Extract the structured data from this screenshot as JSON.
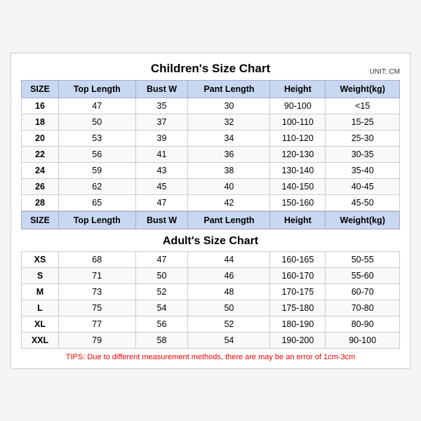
{
  "chart": {
    "unit": "UNIT: CM",
    "children": {
      "title": "Children's Size Chart",
      "headers": [
        "SIZE",
        "Top Length",
        "Bust W",
        "Pant Length",
        "Height",
        "Weight(kg)"
      ],
      "rows": [
        [
          "16",
          "47",
          "35",
          "30",
          "90-100",
          "<15"
        ],
        [
          "18",
          "50",
          "37",
          "32",
          "100-110",
          "15-25"
        ],
        [
          "20",
          "53",
          "39",
          "34",
          "110-120",
          "25-30"
        ],
        [
          "22",
          "56",
          "41",
          "36",
          "120-130",
          "30-35"
        ],
        [
          "24",
          "59",
          "43",
          "38",
          "130-140",
          "35-40"
        ],
        [
          "26",
          "62",
          "45",
          "40",
          "140-150",
          "40-45"
        ],
        [
          "28",
          "65",
          "47",
          "42",
          "150-160",
          "45-50"
        ]
      ]
    },
    "adults": {
      "title": "Adult's Size Chart",
      "headers": [
        "SIZE",
        "Top Length",
        "Bust W",
        "Pant Length",
        "Height",
        "Weight(kg)"
      ],
      "rows": [
        [
          "XS",
          "68",
          "47",
          "44",
          "160-165",
          "50-55"
        ],
        [
          "S",
          "71",
          "50",
          "46",
          "160-170",
          "55-60"
        ],
        [
          "M",
          "73",
          "52",
          "48",
          "170-175",
          "60-70"
        ],
        [
          "L",
          "75",
          "54",
          "50",
          "175-180",
          "70-80"
        ],
        [
          "XL",
          "77",
          "56",
          "52",
          "180-190",
          "80-90"
        ],
        [
          "XXL",
          "79",
          "58",
          "54",
          "190-200",
          "90-100"
        ]
      ]
    },
    "tips": "TIPS: Due to different measurement methods, there are may be an error of 1cm-3cm"
  }
}
